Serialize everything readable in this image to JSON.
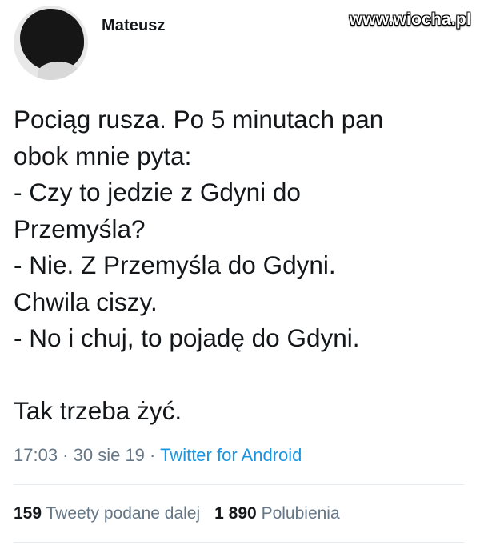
{
  "author": {
    "name": "Mateusz"
  },
  "watermark": "www.wiocha.pl",
  "tweet": {
    "lines": [
      "Pociąg rusza. Po 5 minutach pan",
      "obok mnie pyta:",
      "- Czy to jedzie z Gdyni do",
      "Przemyśla?",
      "- Nie. Z Przemyśla do Gdyni.",
      "Chwila ciszy.",
      "- No i chuj, to pojadę do Gdyni.",
      "Tak trzeba żyć."
    ]
  },
  "meta": {
    "time": "17:03",
    "separator": " · ",
    "date": "30 sie 19",
    "source": "Twitter for Android"
  },
  "stats": {
    "retweets_count": "159",
    "retweets_label": "Tweety podane dalej",
    "likes_count": "1 890",
    "likes_label": "Polubienia"
  },
  "colors": {
    "text": "#14171a",
    "muted": "#657786",
    "link": "#1b95e0",
    "divider": "#e6ecf0"
  }
}
